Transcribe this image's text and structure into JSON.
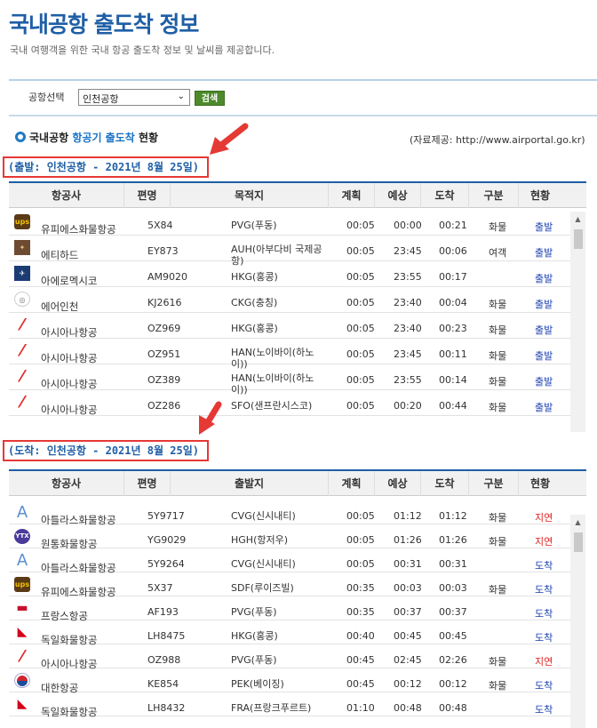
{
  "header": {
    "title": "국내공항 출도착 정보",
    "subtitle": "국내 여행객을 위한 국내 항공 출도착 정보 및 날씨를 제공합니다."
  },
  "search": {
    "label": "공항선택",
    "selected": "인천공항",
    "button": "검색"
  },
  "section": {
    "prefix": "국내공항",
    "highlight": "항공기 출도착",
    "suffix": "현황",
    "source": "(자료제공: http://www.airportal.go.kr)"
  },
  "colors": {
    "accent": "#1f5fa6",
    "caption_border": "#e53935",
    "status_blue": "#1a3fb0",
    "status_red": "#e02020"
  },
  "departure": {
    "caption": "(출발: 인천공항 - 2021년 8월 25일)",
    "headers": [
      "항공사",
      "편명",
      "목적지",
      "계획",
      "예상",
      "도착",
      "구분",
      "현황"
    ],
    "rows": [
      {
        "logo": "ups-logo-icon",
        "airline": "유피에스화물항공",
        "flight": "5X84",
        "place": "PVG(푸동)",
        "plan": "00:05",
        "est": "00:00",
        "arr": "00:21",
        "kind": "화물",
        "status": "출발",
        "status_color": "blue"
      },
      {
        "logo": "etihad-logo-icon",
        "airline": "에티하드",
        "flight": "EY873",
        "place": "AUH(아부다비 국제공항)",
        "plan": "00:05",
        "est": "23:45",
        "arr": "00:06",
        "kind": "여객",
        "status": "출발",
        "status_color": "blue"
      },
      {
        "logo": "aeromexico-logo-icon",
        "airline": "아에로멕시코",
        "flight": "AM9020",
        "place": "HKG(홍콩)",
        "plan": "00:05",
        "est": "23:55",
        "arr": "00:17",
        "kind": "",
        "status": "출발",
        "status_color": "blue"
      },
      {
        "logo": "airincheon-logo-icon",
        "airline": "에어인천",
        "flight": "KJ2616",
        "place": "CKG(충칭)",
        "plan": "00:05",
        "est": "23:40",
        "arr": "00:04",
        "kind": "화물",
        "status": "출발",
        "status_color": "blue"
      },
      {
        "logo": "asiana-logo-icon",
        "airline": "아시아나항공",
        "flight": "OZ969",
        "place": "HKG(홍콩)",
        "plan": "00:05",
        "est": "23:40",
        "arr": "00:23",
        "kind": "화물",
        "status": "출발",
        "status_color": "blue"
      },
      {
        "logo": "asiana-logo-icon",
        "airline": "아시아나항공",
        "flight": "OZ951",
        "place": "HAN(노이바이(하노이))",
        "plan": "00:05",
        "est": "23:45",
        "arr": "00:11",
        "kind": "화물",
        "status": "출발",
        "status_color": "blue"
      },
      {
        "logo": "asiana-logo-icon",
        "airline": "아시아나항공",
        "flight": "OZ389",
        "place": "HAN(노이바이(하노이))",
        "plan": "00:05",
        "est": "23:55",
        "arr": "00:14",
        "kind": "화물",
        "status": "출발",
        "status_color": "blue"
      },
      {
        "logo": "asiana-logo-icon",
        "airline": "아시아나항공",
        "flight": "OZ286",
        "place": "SFO(샌프란시스코)",
        "plan": "00:05",
        "est": "00:20",
        "arr": "00:44",
        "kind": "화물",
        "status": "출발",
        "status_color": "blue"
      }
    ]
  },
  "arrival": {
    "caption": "(도착: 인천공항 - 2021년 8월 25일)",
    "headers": [
      "항공사",
      "편명",
      "출발지",
      "계획",
      "예상",
      "도착",
      "구분",
      "현황"
    ],
    "rows": [
      {
        "logo": "atlas-logo-icon",
        "airline": "아틀라스화물항공",
        "flight": "5Y9717",
        "place": "CVG(신시내티)",
        "plan": "00:05",
        "est": "01:12",
        "arr": "01:12",
        "kind": "화물",
        "status": "지연",
        "status_color": "red"
      },
      {
        "logo": "ytx-logo-icon",
        "airline": "원통화물항공",
        "flight": "YG9029",
        "place": "HGH(항저우)",
        "plan": "00:05",
        "est": "01:26",
        "arr": "01:26",
        "kind": "화물",
        "status": "지연",
        "status_color": "red"
      },
      {
        "logo": "atlas-logo-icon",
        "airline": "아틀라스화물항공",
        "flight": "5Y9264",
        "place": "CVG(신시내티)",
        "plan": "00:05",
        "est": "00:31",
        "arr": "00:31",
        "kind": "",
        "status": "도착",
        "status_color": "blue"
      },
      {
        "logo": "ups-logo-icon",
        "airline": "유피에스화물항공",
        "flight": "5X37",
        "place": "SDF(루이즈빌)",
        "plan": "00:35",
        "est": "00:03",
        "arr": "00:03",
        "kind": "화물",
        "status": "도착",
        "status_color": "blue"
      },
      {
        "logo": "airfrance-logo-icon",
        "airline": "프랑스항공",
        "flight": "AF193",
        "place": "PVG(푸동)",
        "plan": "00:35",
        "est": "00:37",
        "arr": "00:37",
        "kind": "",
        "status": "도착",
        "status_color": "blue"
      },
      {
        "logo": "lufthansa-cargo-logo-icon",
        "airline": "독일화물항공",
        "flight": "LH8475",
        "place": "HKG(홍콩)",
        "plan": "00:40",
        "est": "00:45",
        "arr": "00:45",
        "kind": "",
        "status": "도착",
        "status_color": "blue"
      },
      {
        "logo": "asiana-logo-icon",
        "airline": "아시아나항공",
        "flight": "OZ988",
        "place": "PVG(푸동)",
        "plan": "00:45",
        "est": "02:45",
        "arr": "02:26",
        "kind": "화물",
        "status": "지연",
        "status_color": "red"
      },
      {
        "logo": "koreanair-logo-icon",
        "airline": "대한항공",
        "flight": "KE854",
        "place": "PEK(베이징)",
        "plan": "00:45",
        "est": "00:12",
        "arr": "00:12",
        "kind": "화물",
        "status": "도착",
        "status_color": "blue"
      },
      {
        "logo": "lufthansa-cargo-logo-icon",
        "airline": "독일화물항공",
        "flight": "LH8432",
        "place": "FRA(프랑크푸르트)",
        "plan": "01:10",
        "est": "00:48",
        "arr": "00:48",
        "kind": "",
        "status": "도착",
        "status_color": "blue"
      }
    ]
  }
}
